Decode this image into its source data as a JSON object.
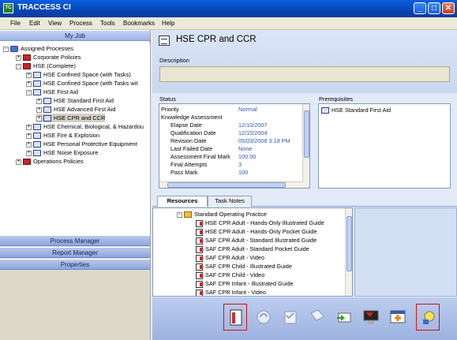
{
  "window": {
    "title": "TRACCESS CI",
    "minimize": "_",
    "maximize": "□",
    "close": "✕"
  },
  "menu": [
    "File",
    "Edit",
    "View",
    "Process",
    "Tools",
    "Bookmarks",
    "Help"
  ],
  "left": {
    "header": "My Job",
    "tree": [
      {
        "label": "Assigned Processes",
        "exp": "−",
        "icon": "group"
      },
      {
        "label": "Corporate Policies",
        "exp": "+",
        "icon": "red"
      },
      {
        "label": "HSE (Complete)",
        "exp": "−",
        "icon": "red"
      },
      {
        "label": "HSE  Confined Space (with Tasks)",
        "exp": "+",
        "icon": "doc"
      },
      {
        "label": "HSE  Confined Space (with Tasks wit",
        "exp": "+",
        "icon": "doc"
      },
      {
        "label": "HSE  First Aid",
        "exp": "−",
        "icon": "doc"
      },
      {
        "label": "HSE  Standard First Aid",
        "exp": "+",
        "icon": "doc"
      },
      {
        "label": "HSE  Advanced First Aid",
        "exp": "+",
        "icon": "doc"
      },
      {
        "label": "HSE  CPR and CCR",
        "exp": "+",
        "icon": "doc"
      },
      {
        "label": "HSE  Chemical, Biological, & Hazardou",
        "exp": "+",
        "icon": "doc"
      },
      {
        "label": "HSE  Fire & Explosion",
        "exp": "+",
        "icon": "doc"
      },
      {
        "label": "HSE  Personal Protective Equipment",
        "exp": "+",
        "icon": "doc"
      },
      {
        "label": "HSE  Noise Exposure",
        "exp": "+",
        "icon": "doc"
      },
      {
        "label": "Operations Policies",
        "exp": "+",
        "icon": "red"
      }
    ],
    "buttons": [
      "Process Manager",
      "Report Manager",
      "Properties"
    ]
  },
  "main": {
    "title": "HSE  CPR and CCR",
    "description_label": "Description",
    "status_label": "Status",
    "status": [
      {
        "k": "Priority",
        "v": "Normal"
      },
      {
        "k": "Knowledge Assessment",
        "v": ""
      },
      {
        "k": "Elapse Date",
        "v": "12/10/2007"
      },
      {
        "k": "Qualification Date",
        "v": "12/10/2004"
      },
      {
        "k": "Revision Date",
        "v": "05/03/2008 3:18 PM"
      },
      {
        "k": "Last Failed Date",
        "v": "None"
      },
      {
        "k": "Assessment Final Mark",
        "v": "100.00"
      },
      {
        "k": "Final Attempts",
        "v": "3"
      },
      {
        "k": "Pass Mark",
        "v": "100"
      }
    ],
    "prereq_label": "Prerequisites",
    "prereqs": [
      "HSE  Standard First Aid"
    ],
    "tabs": [
      "Resources",
      "Task Notes"
    ],
    "resources": [
      {
        "label": "Standard Operating Practice",
        "folder": true
      },
      {
        "label": "HSE  CPR Adult - Hands-Only Illustrated Guide"
      },
      {
        "label": "HSE  CPR Adult - Hands-Only Pocket Guide"
      },
      {
        "label": "SAF  CPR Adult - Standard Illustrated Guide"
      },
      {
        "label": "SAF  CPR Adult - Standard Pocket Guide"
      },
      {
        "label": "SAF  CPR Adult - Video"
      },
      {
        "label": "SAF  CPR Child - Illustrated Guide"
      },
      {
        "label": "SAF  CPR Child - Video"
      },
      {
        "label": "SAF  CPR Infant - Illustrated Guide"
      },
      {
        "label": "SAF  CPR Infant - Video"
      }
    ]
  }
}
